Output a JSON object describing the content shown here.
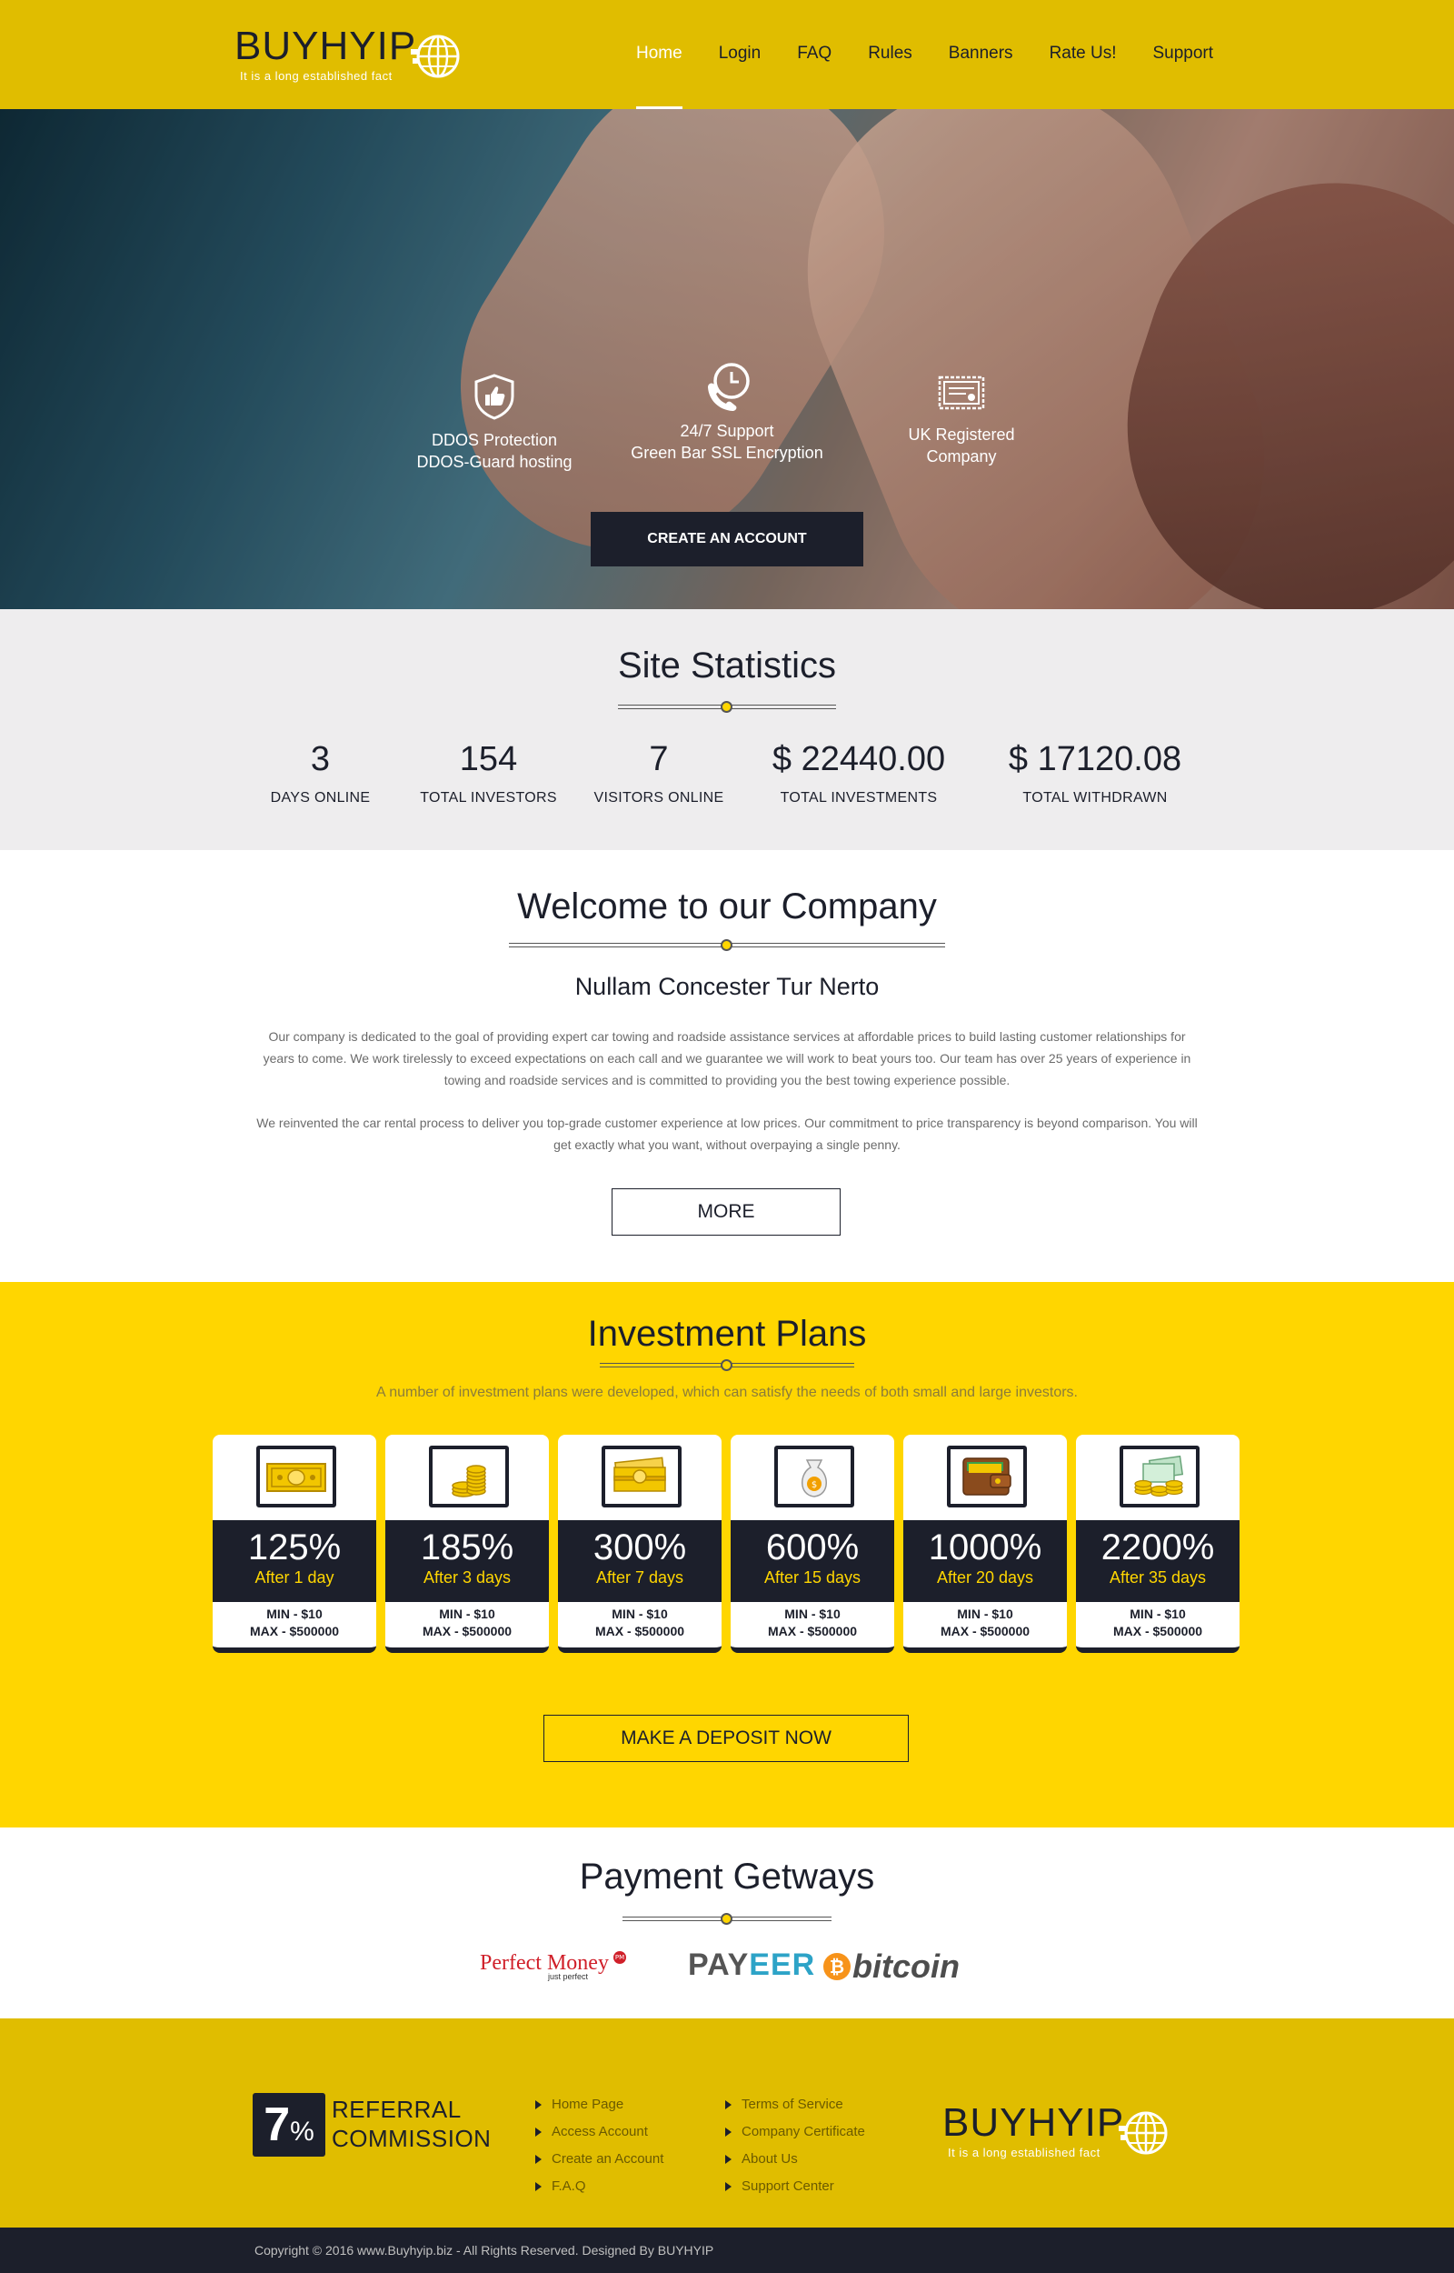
{
  "colors": {
    "header_bg": "#e0bd00",
    "plans_bg": "#ffd600",
    "dark": "#1c1f2b",
    "stats_bg": "#eeedee"
  },
  "brand": {
    "name": "BUYHYIP",
    "tagline": "It is a long established fact"
  },
  "nav": [
    {
      "label": "Home",
      "active": true
    },
    {
      "label": "Login"
    },
    {
      "label": "FAQ"
    },
    {
      "label": "Rules"
    },
    {
      "label": "Banners"
    },
    {
      "label": "Rate Us!"
    },
    {
      "label": "Support"
    }
  ],
  "hero": {
    "features": [
      {
        "icon": "shield-thumbs-up-icon",
        "line1": "DDOS Protection",
        "line2": "DDOS-Guard hosting"
      },
      {
        "icon": "phone-clock-icon",
        "line1": "24/7 Support",
        "line2": "Green Bar SSL Encryption"
      },
      {
        "icon": "certificate-icon",
        "line1": "UK Registered",
        "line2": "Company"
      }
    ],
    "cta": "CREATE AN ACCOUNT"
  },
  "stats": {
    "title": "Site Statistics",
    "items": [
      {
        "value": "3",
        "label": "DAYS ONLINE"
      },
      {
        "value": "154",
        "label": "TOTAL INVESTORS"
      },
      {
        "value": "7",
        "label": "VISITORS ONLINE"
      },
      {
        "value": "$ 22440.00",
        "label": "TOTAL INVESTMENTS"
      },
      {
        "value": "$ 17120.08",
        "label": "TOTAL WITHDRAWN"
      }
    ]
  },
  "welcome": {
    "title": "Welcome to our Company",
    "subtitle": "Nullam Concester Tur Nerto",
    "para1": "Our company is dedicated to the goal of providing expert car towing and roadside assistance services at affordable prices to build lasting customer relationships for years to come. We work tirelessly to exceed expectations on each call and we guarantee we will work to beat yours too. Our team has over 25 years of experience in towing and roadside services and is committed to providing you the best towing experience possible.",
    "para2": "We reinvented the car rental process to deliver you top-grade customer experience at low prices. Our commitment to price transparency is beyond comparison. You will get exactly what you want, without overpaying a single penny.",
    "more": "MORE"
  },
  "plans": {
    "title": "Investment Plans",
    "subtitle": "A number of investment plans were developed, which can satisfy the needs of both small and large investors.",
    "items": [
      {
        "percent": "125%",
        "after": "After 1 day",
        "min": "MIN - $10",
        "max": "MAX -  $500000",
        "icon": "banknote-icon"
      },
      {
        "percent": "185%",
        "after": "After 3 days",
        "min": "MIN - $10",
        "max": "MAX -  $500000",
        "icon": "coin-stack-icon"
      },
      {
        "percent": "300%",
        "after": "After 7 days",
        "min": "MIN - $10",
        "max": "MAX -  $500000",
        "icon": "cash-bundle-icon"
      },
      {
        "percent": "600%",
        "after": "After 15 days",
        "min": "MIN - $10",
        "max": "MAX -  $500000",
        "icon": "money-bag-icon"
      },
      {
        "percent": "1000%",
        "after": "After 20 days",
        "min": "MIN - $10",
        "max": "MAX -  $500000",
        "icon": "wallet-icon"
      },
      {
        "percent": "2200%",
        "after": "After 35 days",
        "min": "MIN - $10",
        "max": "MAX -  $500000",
        "icon": "money-pile-icon"
      }
    ],
    "deposit": "MAKE A DEPOSIT NOW"
  },
  "payment": {
    "title": "Payment Getways",
    "logos": [
      {
        "name": "Perfect Money",
        "sub": "just perfect",
        "badge": "PM"
      },
      {
        "name_a": "PAY",
        "name_b": "EER"
      },
      {
        "name": "bitcoin",
        "symbol": "₿"
      }
    ]
  },
  "footer": {
    "referral": {
      "number": "7",
      "unit": "%",
      "line1": "REFERRAL",
      "line2": "COMMISSION"
    },
    "links_col1": [
      "Home Page",
      "Access Account",
      "Create an Account",
      "F.A.Q"
    ],
    "links_col2": [
      "Terms of Service",
      "Company Certificate",
      "About Us",
      "Support Center"
    ],
    "copyright": "Copyright © 2016 www.Buyhyip.biz - All Rights Reserved. Designed By BUYHYIP"
  }
}
